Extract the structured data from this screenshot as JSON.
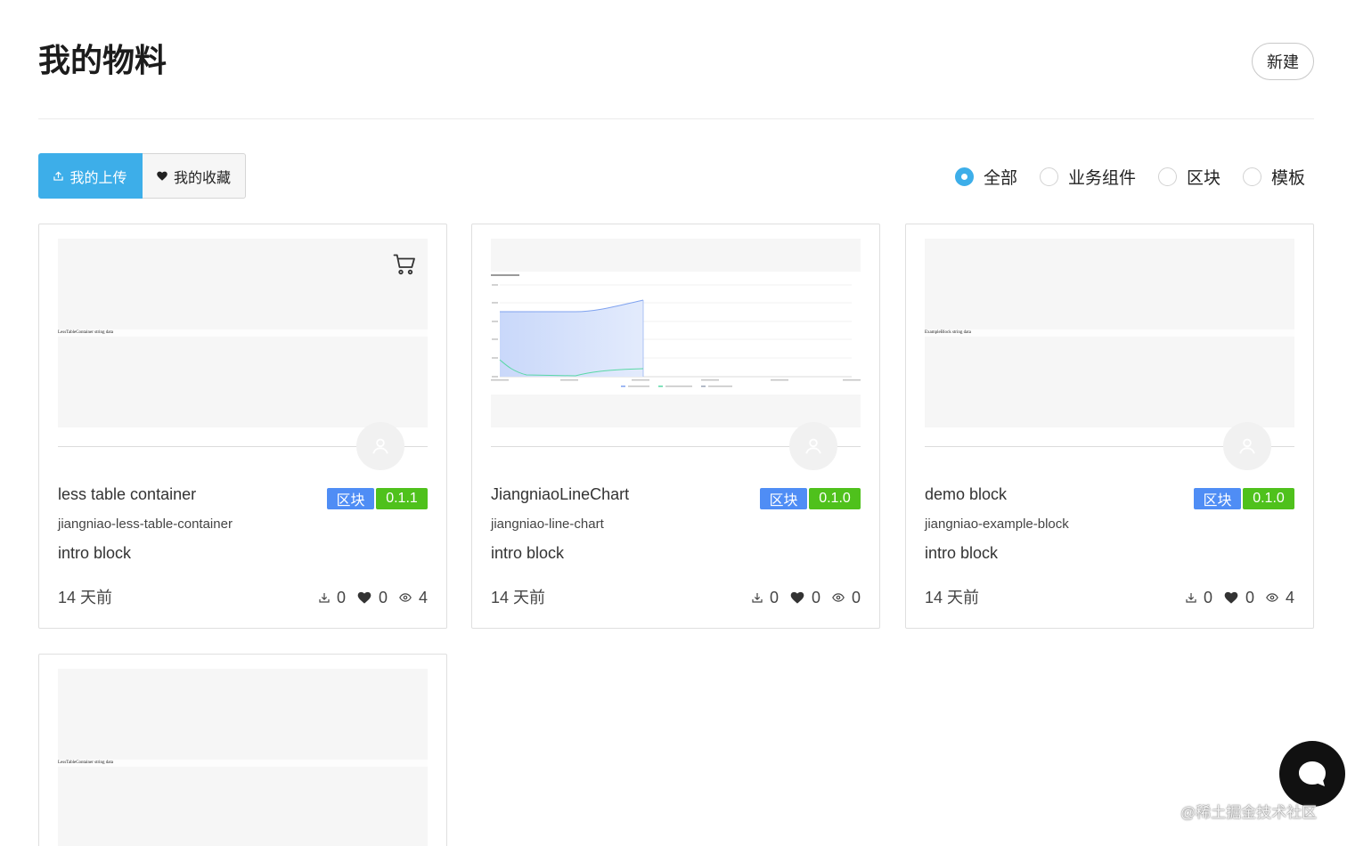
{
  "header": {
    "title": "我的物料",
    "create_label": "新建"
  },
  "tabs": [
    {
      "label": "我的上传",
      "icon": "upload-icon",
      "active": true
    },
    {
      "label": "我的收藏",
      "icon": "heart-icon",
      "active": false
    }
  ],
  "filters": [
    {
      "label": "全部",
      "selected": true
    },
    {
      "label": "业务组件",
      "selected": false
    },
    {
      "label": "区块",
      "selected": false
    },
    {
      "label": "模板",
      "selected": false
    }
  ],
  "cards": [
    {
      "title": "less table container",
      "type_tag": "区块",
      "version": "0.1.1",
      "package": "jiangniao-less-table-container",
      "intro": "intro block",
      "time": "14 天前",
      "downloads": 0,
      "likes": 0,
      "views": 4,
      "preview_text": "LessTableContainer string data",
      "action_icon": "cart-icon",
      "avatar_icon": "user-icon"
    },
    {
      "title": "JiangniaoLineChart",
      "type_tag": "区块",
      "version": "0.1.0",
      "package": "jiangniao-line-chart",
      "intro": "intro block",
      "time": "14 天前",
      "downloads": 0,
      "likes": 0,
      "views": 0,
      "avatar_icon": "user-icon"
    },
    {
      "title": "demo block",
      "type_tag": "区块",
      "version": "0.1.0",
      "package": "jiangniao-example-block",
      "intro": "intro block",
      "time": "14 天前",
      "downloads": 0,
      "likes": 0,
      "views": 4,
      "preview_text": "ExampleBlock string data",
      "avatar_icon": "user-icon"
    },
    {
      "preview_text": "LessTableContainer string data"
    }
  ],
  "stat_icons": [
    "download-icon",
    "heart-icon",
    "eye-icon"
  ],
  "floating_button": {
    "icon": "chat-bubble-icon"
  },
  "watermark": "@稀土掘金技术社区",
  "colors": {
    "accent": "#3daee9",
    "tag-blue": "#4f8df5",
    "tag-green": "#4fc11c"
  }
}
